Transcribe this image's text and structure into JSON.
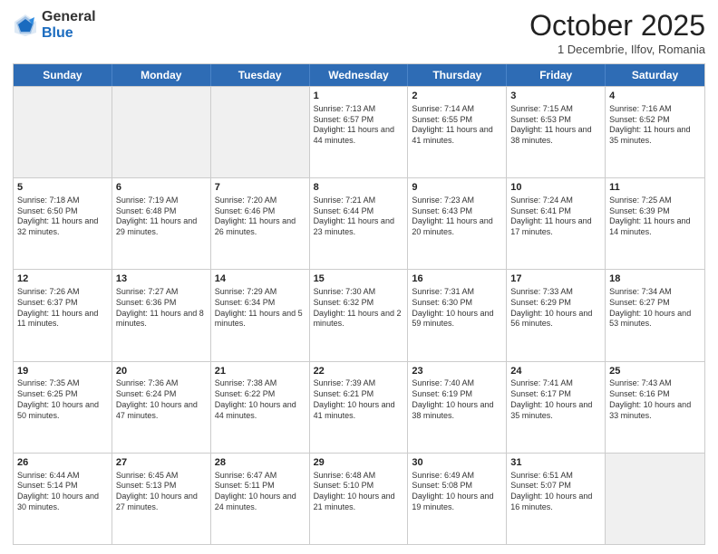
{
  "header": {
    "logo_general": "General",
    "logo_blue": "Blue",
    "month_title": "October 2025",
    "subtitle": "1 Decembrie, Ilfov, Romania"
  },
  "weekdays": [
    "Sunday",
    "Monday",
    "Tuesday",
    "Wednesday",
    "Thursday",
    "Friday",
    "Saturday"
  ],
  "rows": [
    [
      {
        "day": "",
        "info": "",
        "shaded": true
      },
      {
        "day": "",
        "info": "",
        "shaded": true
      },
      {
        "day": "",
        "info": "",
        "shaded": true
      },
      {
        "day": "1",
        "info": "Sunrise: 7:13 AM\nSunset: 6:57 PM\nDaylight: 11 hours and 44 minutes."
      },
      {
        "day": "2",
        "info": "Sunrise: 7:14 AM\nSunset: 6:55 PM\nDaylight: 11 hours and 41 minutes."
      },
      {
        "day": "3",
        "info": "Sunrise: 7:15 AM\nSunset: 6:53 PM\nDaylight: 11 hours and 38 minutes."
      },
      {
        "day": "4",
        "info": "Sunrise: 7:16 AM\nSunset: 6:52 PM\nDaylight: 11 hours and 35 minutes."
      }
    ],
    [
      {
        "day": "5",
        "info": "Sunrise: 7:18 AM\nSunset: 6:50 PM\nDaylight: 11 hours and 32 minutes."
      },
      {
        "day": "6",
        "info": "Sunrise: 7:19 AM\nSunset: 6:48 PM\nDaylight: 11 hours and 29 minutes."
      },
      {
        "day": "7",
        "info": "Sunrise: 7:20 AM\nSunset: 6:46 PM\nDaylight: 11 hours and 26 minutes."
      },
      {
        "day": "8",
        "info": "Sunrise: 7:21 AM\nSunset: 6:44 PM\nDaylight: 11 hours and 23 minutes."
      },
      {
        "day": "9",
        "info": "Sunrise: 7:23 AM\nSunset: 6:43 PM\nDaylight: 11 hours and 20 minutes."
      },
      {
        "day": "10",
        "info": "Sunrise: 7:24 AM\nSunset: 6:41 PM\nDaylight: 11 hours and 17 minutes."
      },
      {
        "day": "11",
        "info": "Sunrise: 7:25 AM\nSunset: 6:39 PM\nDaylight: 11 hours and 14 minutes."
      }
    ],
    [
      {
        "day": "12",
        "info": "Sunrise: 7:26 AM\nSunset: 6:37 PM\nDaylight: 11 hours and 11 minutes."
      },
      {
        "day": "13",
        "info": "Sunrise: 7:27 AM\nSunset: 6:36 PM\nDaylight: 11 hours and 8 minutes."
      },
      {
        "day": "14",
        "info": "Sunrise: 7:29 AM\nSunset: 6:34 PM\nDaylight: 11 hours and 5 minutes."
      },
      {
        "day": "15",
        "info": "Sunrise: 7:30 AM\nSunset: 6:32 PM\nDaylight: 11 hours and 2 minutes."
      },
      {
        "day": "16",
        "info": "Sunrise: 7:31 AM\nSunset: 6:30 PM\nDaylight: 10 hours and 59 minutes."
      },
      {
        "day": "17",
        "info": "Sunrise: 7:33 AM\nSunset: 6:29 PM\nDaylight: 10 hours and 56 minutes."
      },
      {
        "day": "18",
        "info": "Sunrise: 7:34 AM\nSunset: 6:27 PM\nDaylight: 10 hours and 53 minutes."
      }
    ],
    [
      {
        "day": "19",
        "info": "Sunrise: 7:35 AM\nSunset: 6:25 PM\nDaylight: 10 hours and 50 minutes."
      },
      {
        "day": "20",
        "info": "Sunrise: 7:36 AM\nSunset: 6:24 PM\nDaylight: 10 hours and 47 minutes."
      },
      {
        "day": "21",
        "info": "Sunrise: 7:38 AM\nSunset: 6:22 PM\nDaylight: 10 hours and 44 minutes."
      },
      {
        "day": "22",
        "info": "Sunrise: 7:39 AM\nSunset: 6:21 PM\nDaylight: 10 hours and 41 minutes."
      },
      {
        "day": "23",
        "info": "Sunrise: 7:40 AM\nSunset: 6:19 PM\nDaylight: 10 hours and 38 minutes."
      },
      {
        "day": "24",
        "info": "Sunrise: 7:41 AM\nSunset: 6:17 PM\nDaylight: 10 hours and 35 minutes."
      },
      {
        "day": "25",
        "info": "Sunrise: 7:43 AM\nSunset: 6:16 PM\nDaylight: 10 hours and 33 minutes."
      }
    ],
    [
      {
        "day": "26",
        "info": "Sunrise: 6:44 AM\nSunset: 5:14 PM\nDaylight: 10 hours and 30 minutes."
      },
      {
        "day": "27",
        "info": "Sunrise: 6:45 AM\nSunset: 5:13 PM\nDaylight: 10 hours and 27 minutes."
      },
      {
        "day": "28",
        "info": "Sunrise: 6:47 AM\nSunset: 5:11 PM\nDaylight: 10 hours and 24 minutes."
      },
      {
        "day": "29",
        "info": "Sunrise: 6:48 AM\nSunset: 5:10 PM\nDaylight: 10 hours and 21 minutes."
      },
      {
        "day": "30",
        "info": "Sunrise: 6:49 AM\nSunset: 5:08 PM\nDaylight: 10 hours and 19 minutes."
      },
      {
        "day": "31",
        "info": "Sunrise: 6:51 AM\nSunset: 5:07 PM\nDaylight: 10 hours and 16 minutes."
      },
      {
        "day": "",
        "info": "",
        "shaded": true
      }
    ]
  ]
}
